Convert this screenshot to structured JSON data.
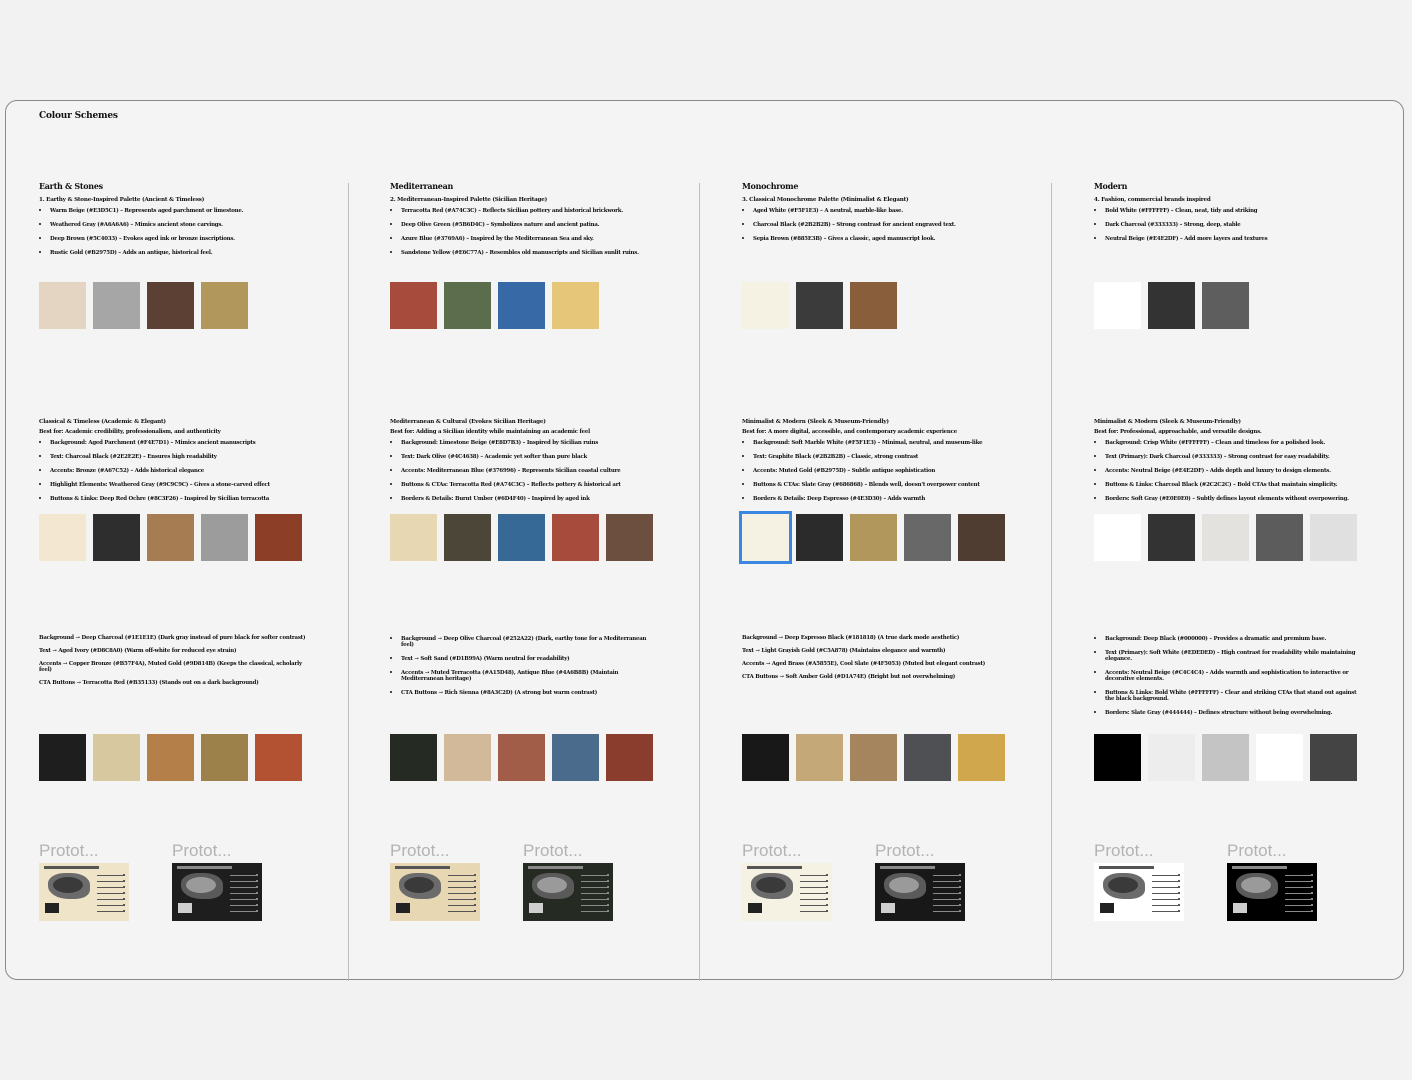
{
  "board": {
    "title": "Colour Schemes"
  },
  "columns": [
    {
      "title": "Earth & Stones",
      "blocks": [
        {
          "heading": "1. Earthy & Stone-Inspired Palette (Ancient & Timeless)",
          "items": [
            "Warm Beige (#E3D5C1) – Represents aged parchment or limestone.",
            "Weathered Gray (#A6A6A6) – Mimics ancient stone carvings.",
            "Deep Brown (#5C4033) – Evokes aged ink or bronze inscriptions.",
            "Rustic Gold (#B2975D) – Adds an antique, historical feel."
          ],
          "swatches": [
            "#E3D5C1",
            "#A6A6A6",
            "#5C4033",
            "#B2975D"
          ]
        },
        {
          "heading": "Classical & Timeless (Academic & Elegant)",
          "bestfor": "Best for: Academic credibility, professionalism, and authenticity",
          "items": [
            "Background: Aged Parchment (#F4E7D1) – Mimics ancient manuscripts",
            "Text: Charcoal Black (#2E2E2E) – Ensures high readability",
            "Accents: Bronze (#A67C52) – Adds historical elegance",
            "Highlight Elements: Weathered Gray (#9C9C9C) – Gives a stone-carved effect",
            "Buttons & Links: Deep Red Ochre (#8C3F26) – Inspired by Sicilian terracotta"
          ],
          "swatches": [
            "#F4E7D1",
            "#2E2E2E",
            "#A67C52",
            "#9C9C9C",
            "#8C3F26"
          ]
        },
        {
          "plain": true,
          "items": [
            "Background → Deep Charcoal (#1E1E1E) (Dark gray instead of pure black for softer contrast)",
            "Text → Aged Ivory (#D8C8A0) (Warm off-white for reduced eye strain)",
            "Accents → Copper Bronze (#B57F4A), Muted Gold (#9D814B) (Keeps the classical, scholarly feel)",
            "CTA Buttons → Terracotta Red (#B35133) (Stands out on a dark background)"
          ],
          "swatches": [
            "#1E1E1E",
            "#D8C8A0",
            "#B57F4A",
            "#9D814B",
            "#B35133"
          ]
        }
      ],
      "protos": [
        {
          "label": "Protot...",
          "theme": "light",
          "bg": "#EFE3C8"
        },
        {
          "label": "Protot...",
          "theme": "dark",
          "bg": "#1E1E1E"
        }
      ]
    },
    {
      "title": "Mediterranean",
      "blocks": [
        {
          "heading": "2. Mediterranean-Inspired Palette (Sicilian Heritage)",
          "items": [
            "Terracotta Red (#A74C3C) – Reflects Sicilian pottery and historical brickwork.",
            "Deep Olive Green (#5B6D4C) – Symbolizes nature and ancient patina.",
            "Azure Blue (#3769A6) – Inspired by the Mediterranean Sea and sky.",
            "Sandstone Yellow (#E6C77A) – Resembles old manuscripts and Sicilian sunlit ruins."
          ],
          "swatches": [
            "#A74C3C",
            "#5B6D4C",
            "#3769A6",
            "#E6C77A"
          ]
        },
        {
          "heading": "Mediterranean & Cultural (Evokes Sicilian Heritage)",
          "bestfor": "Best for: Adding a Sicilian identity while maintaining an academic feel",
          "items": [
            "Background: Limestone Beige (#E8D7B3) – Inspired by Sicilian ruins",
            "Text: Dark Olive (#4C4638) – Academic yet softer than pure black",
            "Accents: Mediterranean Blue (#376996) – Represents Sicilian coastal culture",
            "Buttons & CTAs: Terracotta Red (#A74C3C) – Reflects pottery & historical art",
            "Borders & Details: Burnt Umber (#6D4F40) – Inspired by aged ink"
          ],
          "swatches": [
            "#E8D7B3",
            "#4C4638",
            "#376996",
            "#A74C3C",
            "#6D4F40"
          ]
        },
        {
          "plain": false,
          "items": [
            "Background → Deep Olive Charcoal (#252A22) (Dark, earthy tone for a Mediterranean feel)",
            "Text → Soft Sand (#D1B99A) (Warm neutral for readability)",
            "Accents → Muted Terracotta (#A15D48), Antique Blue (#4A6B8B) (Maintain Mediterranean heritage)",
            "CTA Buttons → Rich Sienna (#8A3C2D) (A strong but warm contrast)"
          ],
          "swatches": [
            "#252A22",
            "#D1B99A",
            "#A15D48",
            "#4A6B8B",
            "#8A3C2D"
          ]
        }
      ],
      "protos": [
        {
          "label": "Protot...",
          "theme": "light",
          "bg": "#E8D7B3"
        },
        {
          "label": "Protot...",
          "theme": "dark",
          "bg": "#252A22"
        }
      ]
    },
    {
      "title": "Monochrome",
      "blocks": [
        {
          "heading": "3. Classical Monochrome Palette (Minimalist & Elegant)",
          "items": [
            "Aged White (#F5F1E3) – A neutral, marble-like base.",
            "Charcoal Black (#2B2B2B) – Strong contrast for ancient engraved text.",
            "Sepia Brown (#885E3B) – Gives a classic, aged manuscript look."
          ],
          "swatches": [
            "#F5F1E3",
            "#3B3B3B",
            "#885E3B"
          ]
        },
        {
          "heading": "Minimalist & Modern (Sleek & Museum-Friendly)",
          "bestfor": "Best for: A more digital, accessible, and contemporary academic experience",
          "items": [
            "Background: Soft Marble White (#F5F1E3) – Minimal, neutral, and museum-like",
            "Text: Graphite Black (#2B2B2B) – Classic, strong contrast",
            "Accents: Muted Gold (#B2975D) – Subtle antique sophistication",
            "Buttons & CTAs: Slate Gray (#686868) – Blends well, doesn't overpower content",
            "Borders & Details: Deep Espresso (#4E3D30) – Adds warmth"
          ],
          "swatches": [
            "#F5F1E3",
            "#2B2B2B",
            "#B2975D",
            "#686868",
            "#4E3D30"
          ]
        },
        {
          "plain": true,
          "items": [
            "Background → Deep Espresso Black (#181818) (A true dark mode aesthetic)",
            "Text → Light Grayish Gold (#C5A878) (Maintains elegance and warmth)",
            "Accents → Aged Brass (#A5855E), Cool Slate (#4F5053) (Muted but elegant contrast)",
            "CTA Buttons → Soft Amber Gold (#D1A74E) (Bright but not overwhelming)"
          ],
          "swatches": [
            "#181818",
            "#C5A878",
            "#A5855E",
            "#4F5053",
            "#D1A74E"
          ]
        }
      ],
      "protos": [
        {
          "label": "Protot...",
          "theme": "light",
          "bg": "#F5F1E3"
        },
        {
          "label": "Protot...",
          "theme": "dark",
          "bg": "#181818"
        }
      ]
    },
    {
      "title": "Modern",
      "blocks": [
        {
          "heading": "4. Fashion, commercial brands inspired",
          "items": [
            "Bold White (#FFFFFF) – Clean, neat, tidy and striking",
            "Dark Charcoal (#333333) – Strong, deep, stable",
            "Neutral Beige (#E4E2DF) – Add more layers and textures"
          ],
          "swatches": [
            "#FFFFFF",
            "#333333",
            "#5E5E5E"
          ]
        },
        {
          "heading": "Minimalist & Modern (Sleek & Museum-Friendly)",
          "bestfor": "Best for: Professional, approachable, and versatile designs.",
          "items": [
            "Background: Crisp White (#FFFFFF) – Clean and timeless for a polished look.",
            "Text (Primary): Dark Charcoal (#333333) – Strong contrast for easy readability.",
            "Accents: Neutral Beige (#E4E2DF) – Adds depth and luxury to design elements.",
            "Buttons & Links: Charcoal Black (#2C2C2C) – Bold CTAs that maintain simplicity.",
            "Borders: Soft Gray (#E0E0E0) – Subtly defines layout elements without overpowering."
          ],
          "swatches": [
            "#FFFFFF",
            "#333333",
            "#E4E2DF",
            "#5C5C5C",
            "#E0E0E0"
          ]
        },
        {
          "plain": false,
          "items": [
            "Background: Deep Black (#000000) – Provides a dramatic and premium base.",
            "Text (Primary): Soft White (#EDEDED) – High contrast for readability while maintaining elegance.",
            "Accents: Neutral Beige (#C4C4C4) – Adds warmth and sophistication to interactive or decorative elements.",
            "Buttons & Links: Bold White (#FFFFFF) – Clear and striking CTAs that stand out against the black background.",
            "Borders: Slate Gray (#444444) – Defines structure without being overwhelming."
          ],
          "swatches": [
            "#000000",
            "#EDEDED",
            "#C4C4C4",
            "#FFFFFF",
            "#444444"
          ]
        }
      ],
      "protos": [
        {
          "label": "Protot...",
          "theme": "light",
          "bg": "#FFFFFF"
        },
        {
          "label": "Protot...",
          "theme": "dark",
          "bg": "#000000"
        }
      ]
    }
  ],
  "selected_swatch": {
    "column": 2,
    "block": 1,
    "index": 0
  }
}
